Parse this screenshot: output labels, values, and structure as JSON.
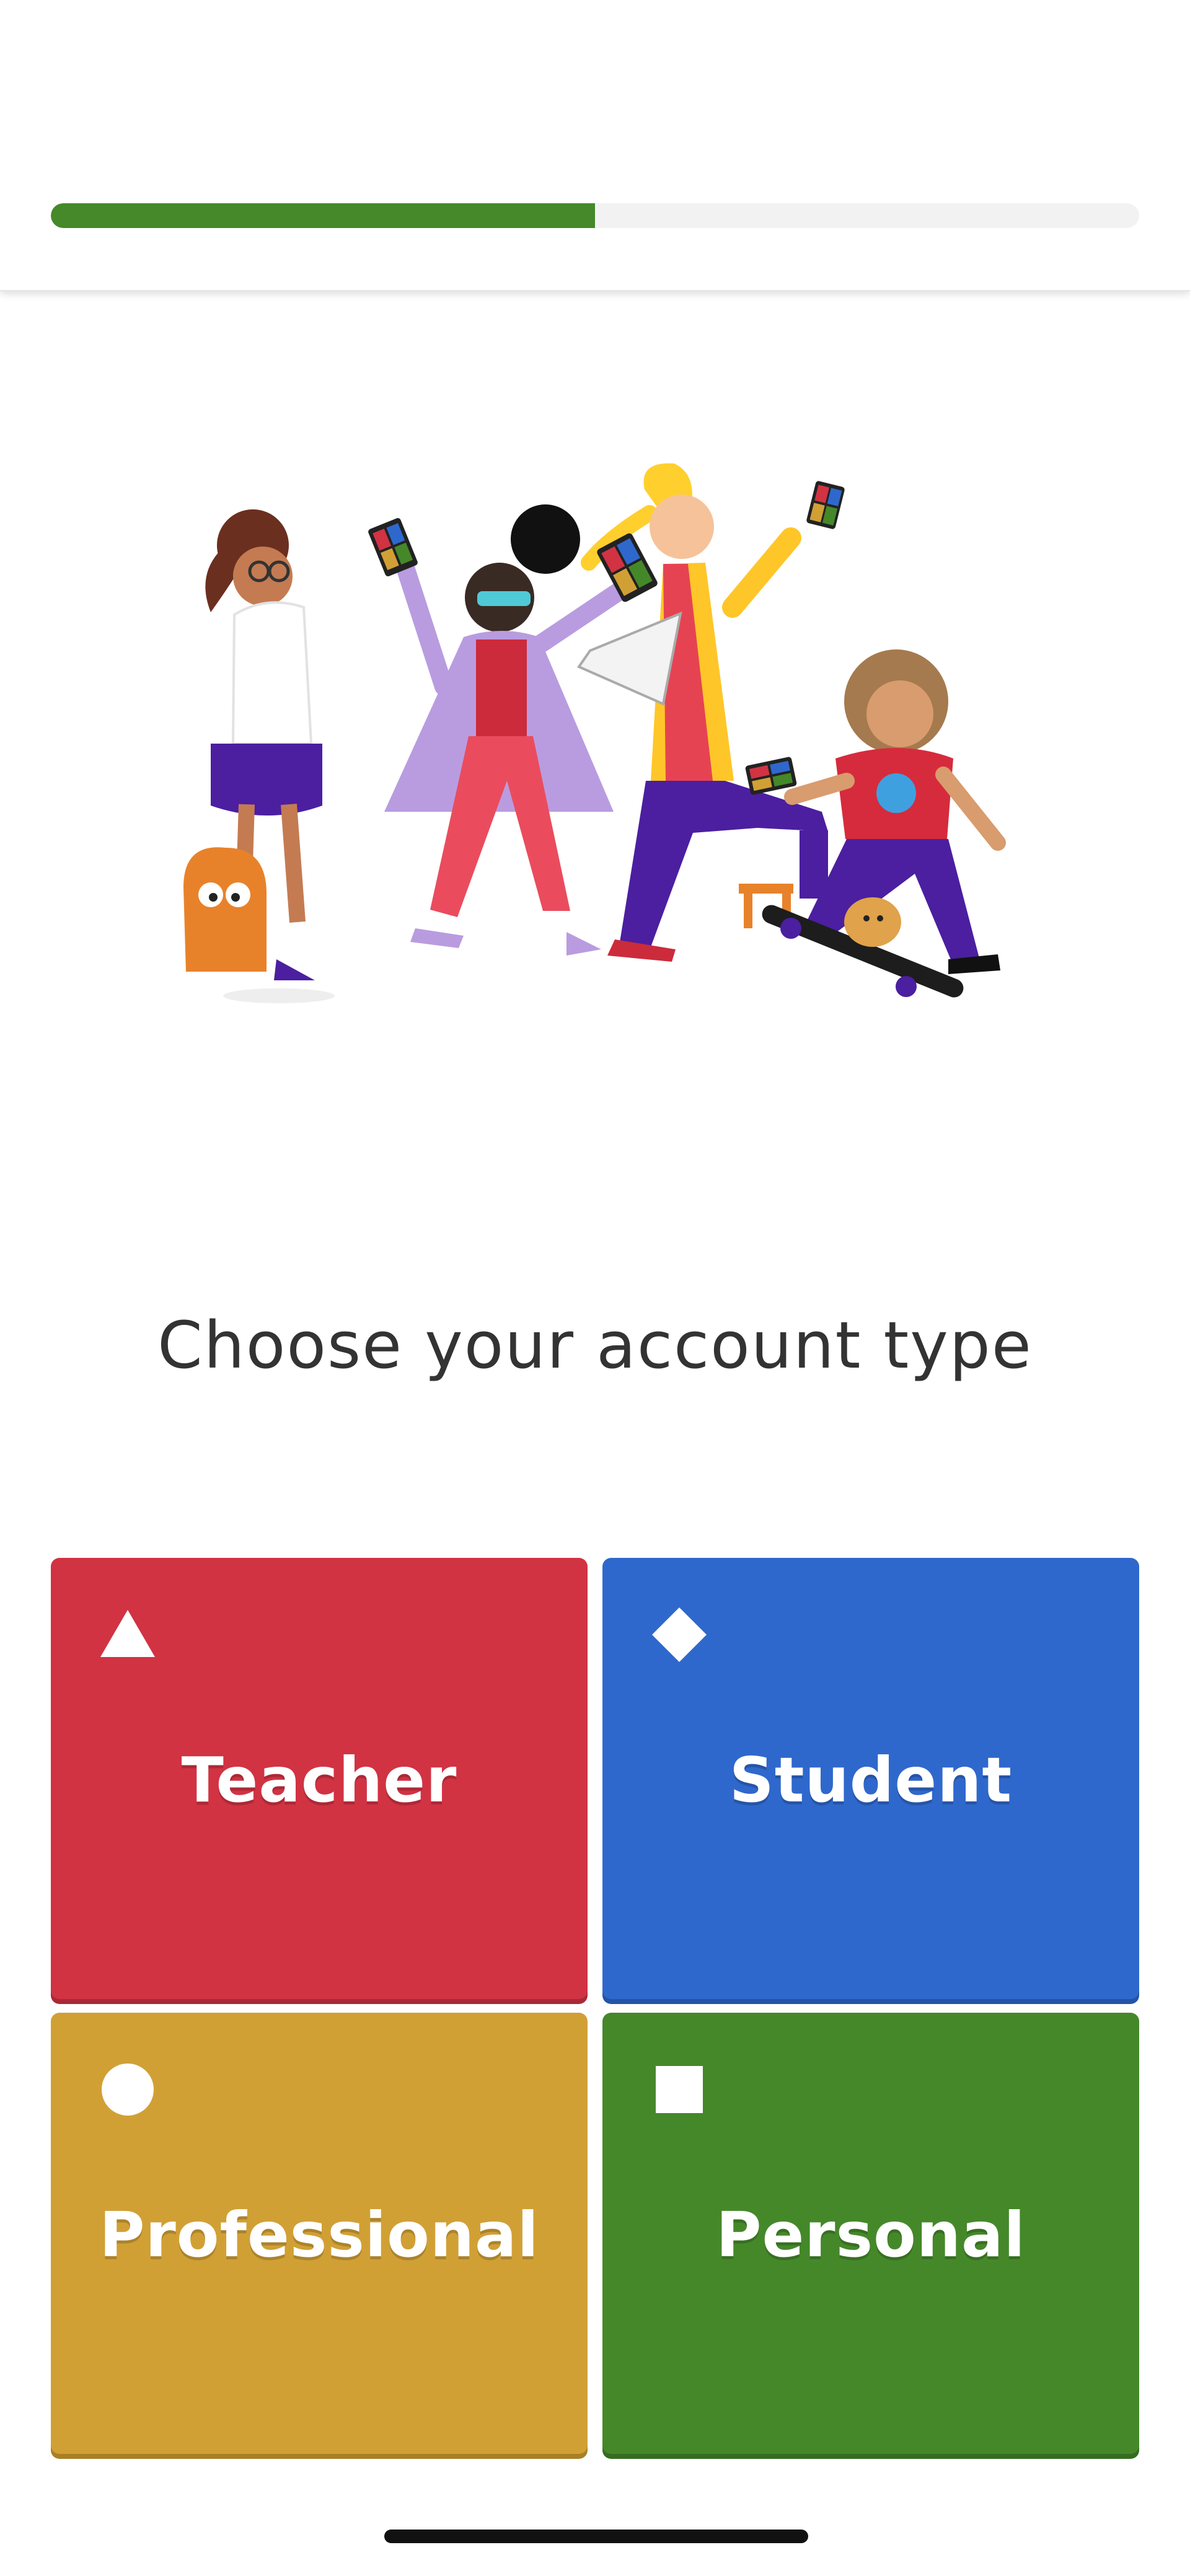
{
  "progress": {
    "value": 0.5,
    "color": "#45892a"
  },
  "heading": "Choose your account type",
  "options": [
    {
      "label": "Teacher",
      "icon": "triangle-icon",
      "color": "#d13343"
    },
    {
      "label": "Student",
      "icon": "diamond-icon",
      "color": "#2f68cc"
    },
    {
      "label": "Professional",
      "icon": "circle-icon",
      "color": "#d1a035"
    },
    {
      "label": "Personal",
      "icon": "square-icon",
      "color": "#45882a"
    }
  ]
}
